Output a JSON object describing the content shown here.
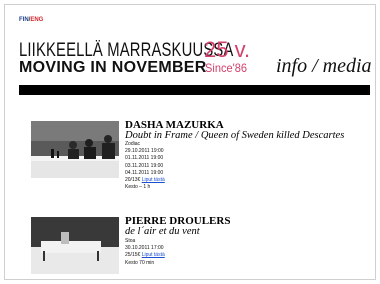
{
  "lang": {
    "fin": "FIN",
    "sep": "/",
    "eng": "ENG"
  },
  "header": {
    "line1": "LIIKKEELLÄ MARRASKUUSSA",
    "anniv": "25 v.",
    "line2": "MOVING IN NOVEMBER",
    "since": "Since'86",
    "section": "info / media"
  },
  "colors": {
    "brand_pink": "#d2426b",
    "lang_fin": "#1a3f8a",
    "lang_eng": "#d4242a",
    "link": "#1a4fd0"
  },
  "events": [
    {
      "artist": "DASHA MAZURKA",
      "work": "Doubt in Frame / Queen of Sweden killed Descartes",
      "venue": "Zodiac",
      "dates": [
        "29.10.2011 19:00",
        "01.11.2011 19:00",
        "03.11.2011 19:00",
        "04.11.2011 19:00"
      ],
      "price": "20/13€",
      "ticket_link": "Liput tästä",
      "duration": "Kesto – 1 h"
    },
    {
      "artist": "PIERRE DROULERS",
      "work": "de l´air et du vent",
      "venue": "Stoa",
      "dates": [
        "30.10.2011 17:00"
      ],
      "price": "25/15€",
      "ticket_link": "Liput tästä",
      "duration": "Kesto 70 min"
    }
  ]
}
